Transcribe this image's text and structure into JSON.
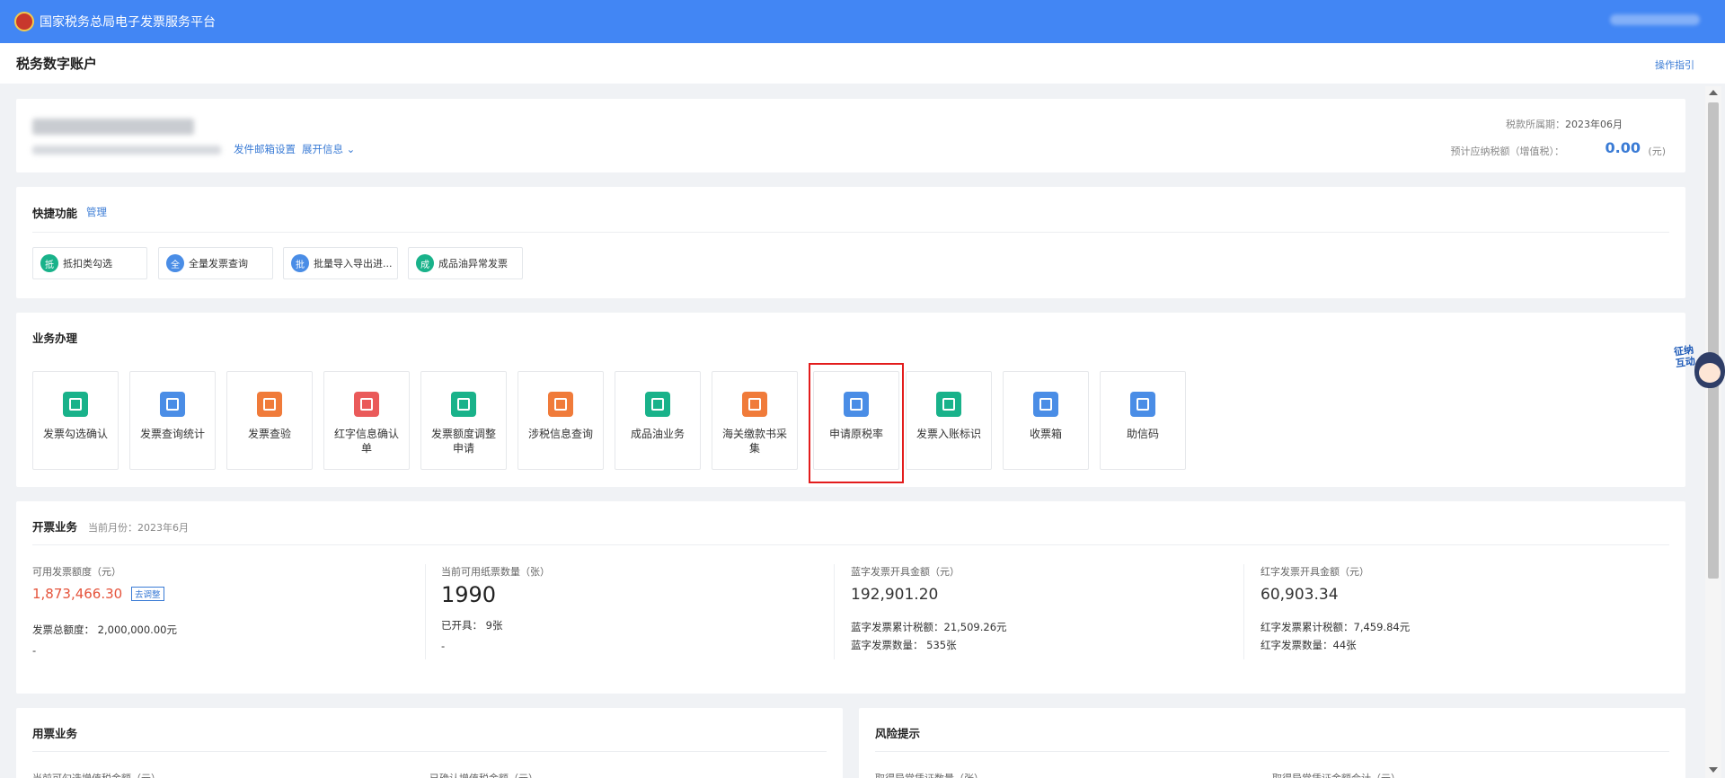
{
  "header": {
    "title": "国家税务总局电子发票服务平台"
  },
  "subheader": {
    "page_title": "税务数字账户",
    "guide": "操作指引"
  },
  "company": {
    "mail_settings": "发件邮箱设置",
    "expand_info": "展开信息",
    "tax_period_label": "税款所属期：",
    "tax_period_value": "2023年06月",
    "est_tax_label": "预计应纳税额（增值税）：",
    "est_tax_value": "0.00",
    "est_tax_unit": "(元)"
  },
  "quick": {
    "title": "快捷功能",
    "manage": "管理",
    "items": [
      {
        "badge": "抵",
        "label": "抵扣类勾选",
        "color": "#19b28a"
      },
      {
        "badge": "全",
        "label": "全量发票查询",
        "color": "#4a8de6"
      },
      {
        "badge": "批",
        "label": "批量导入导出进...",
        "color": "#4a8de6"
      },
      {
        "badge": "成",
        "label": "成品油异常发票",
        "color": "#19b28a"
      }
    ]
  },
  "business": {
    "title": "业务办理",
    "tiles": [
      {
        "label": "发票勾选确认",
        "color": "#19b28a",
        "icon": "ticket-icon"
      },
      {
        "label": "发票查询统计",
        "color": "#4a8de6",
        "icon": "search-doc-icon"
      },
      {
        "label": "发票查验",
        "color": "#f07b3a",
        "icon": "verify-ticket-icon"
      },
      {
        "label": "红字信息确认单",
        "color": "#ea5a5a",
        "icon": "red-doc-icon"
      },
      {
        "label": "发票额度调整申请",
        "color": "#19b28a",
        "icon": "edit-doc-icon"
      },
      {
        "label": "涉税信息查询",
        "color": "#f07b3a",
        "icon": "tax-search-icon"
      },
      {
        "label": "成品油业务",
        "color": "#19b28a",
        "icon": "oil-icon"
      },
      {
        "label": "海关缴款书采集",
        "color": "#f07b3a",
        "icon": "customs-doc-icon"
      },
      {
        "label": "申请原税率",
        "color": "#4a8de6",
        "icon": "apply-rate-icon"
      },
      {
        "label": "发票入账标识",
        "color": "#19b28a",
        "icon": "account-mark-icon"
      },
      {
        "label": "收票箱",
        "color": "#4a8de6",
        "icon": "mail-icon"
      },
      {
        "label": "助信码",
        "color": "#4a8de6",
        "icon": "qr-code-icon"
      }
    ]
  },
  "invoicing": {
    "title": "开票业务",
    "month": "当前月份：2023年6月",
    "available_quota_label": "可用发票额度（元）",
    "available_quota_value": "1,873,466.30",
    "adjust_tag": "去调整",
    "total_quota_line": "发票总额度：  2,000,000.00元",
    "dash1": "-",
    "paper_count_label": "当前可用纸票数量（张）",
    "paper_count_value": "1990",
    "issued_line": "已开具：  9张",
    "dash2": "-",
    "blue_amount_label": "蓝字发票开具金额（元）",
    "blue_amount_value": "192,901.20",
    "blue_tax_line": "蓝字发票累计税额：21,509.26元",
    "blue_count_line": "蓝字发票数量：  535张",
    "red_amount_label": "红字发票开具金额（元）",
    "red_amount_value": "60,903.34",
    "red_tax_line": "红字发票累计税额：7,459.84元",
    "red_count_line": "红字发票数量：44张"
  },
  "usage": {
    "title": "用票业务",
    "col1": "当前可勾选增值税金额（元）",
    "col2": "已确认增值税金额（元）"
  },
  "risk": {
    "title": "风险提示",
    "col1": "取得异常凭证数量（张）",
    "col2": "取得异常凭证金额合计（元）"
  },
  "assistant": {
    "text": "征纳互动"
  }
}
